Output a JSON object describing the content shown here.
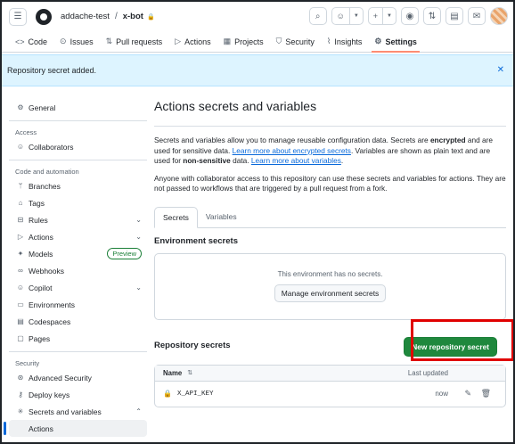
{
  "header": {
    "owner": "addache-test",
    "repo": "x-bot"
  },
  "nav": {
    "tabs": [
      {
        "label": "Code",
        "icon": "code-icon"
      },
      {
        "label": "Issues",
        "icon": "issue-icon"
      },
      {
        "label": "Pull requests",
        "icon": "pull-request-icon"
      },
      {
        "label": "Actions",
        "icon": "play-icon"
      },
      {
        "label": "Projects",
        "icon": "table-icon"
      },
      {
        "label": "Security",
        "icon": "shield-icon"
      },
      {
        "label": "Insights",
        "icon": "graph-icon"
      },
      {
        "label": "Settings",
        "icon": "gear-icon",
        "active": true
      }
    ]
  },
  "flash": {
    "message": "Repository secret added."
  },
  "sidebar": {
    "general": "General",
    "access_heading": "Access",
    "collaborators": "Collaborators",
    "code_heading": "Code and automation",
    "items": [
      "Branches",
      "Tags",
      "Rules",
      "Actions",
      "Models",
      "Webhooks",
      "Copilot",
      "Environments",
      "Codespaces",
      "Pages"
    ],
    "models_badge": "Preview",
    "security_heading": "Security",
    "security_items": [
      "Advanced Security",
      "Deploy keys",
      "Secrets and variables"
    ],
    "sub_active": "Actions"
  },
  "main": {
    "title": "Actions secrets and variables",
    "intro_1": "Secrets and variables allow you to manage reusable configuration data. Secrets are ",
    "intro_bold_1": "encrypted",
    "intro_2": " and are used for sensitive data. ",
    "intro_link_1": "Learn more about encrypted secrets",
    "intro_3": ". Variables are shown as plain text and are used for ",
    "intro_bold_2": "non-sensitive",
    "intro_4": " data. ",
    "intro_link_2": "Learn more about variables",
    "intro_5": ".",
    "access_note": "Anyone with collaborator access to this repository can use these secrets and variables for actions. They are not passed to workflows that are triggered by a pull request from a fork.",
    "tabs": [
      "Secrets",
      "Variables"
    ],
    "env_heading": "Environment secrets",
    "env_empty": "This environment has no secrets.",
    "env_button": "Manage environment secrets",
    "repo_heading": "Repository secrets",
    "new_secret_button": "New repository secret",
    "table": {
      "col_name": "Name",
      "col_updated": "Last updated",
      "rows": [
        {
          "name": "X_API_KEY",
          "updated": "now"
        }
      ]
    }
  }
}
